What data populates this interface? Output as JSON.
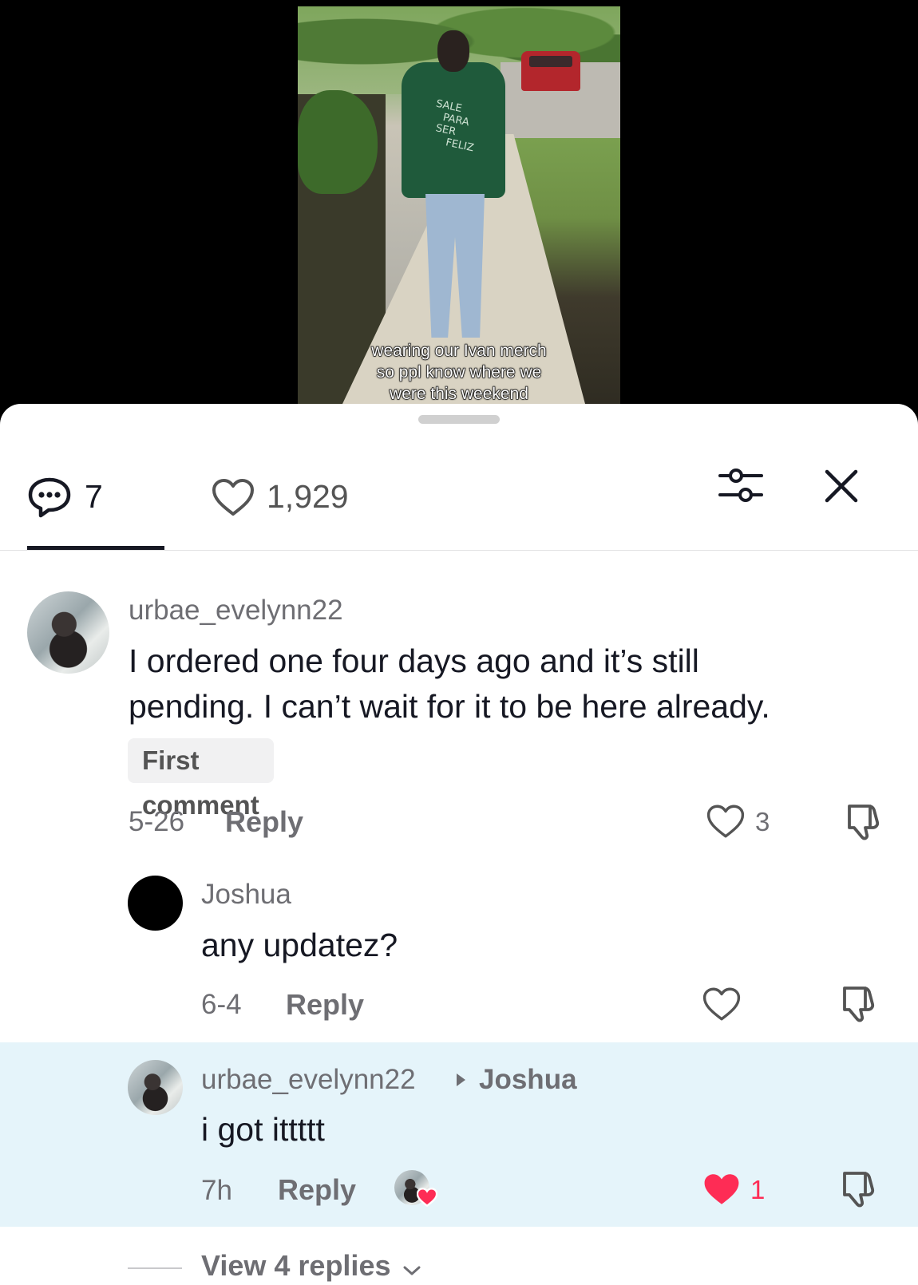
{
  "video": {
    "caption_lines": [
      "wearing our Ivan merch",
      "so ppl know where we",
      "were this weekend"
    ],
    "hoodie_text": [
      "SALE",
      "PARA",
      "SER",
      "FELIZ"
    ]
  },
  "tabs": {
    "comments_count": "7",
    "likes_count": "1,929",
    "active_tab": "comments"
  },
  "comments": [
    {
      "username": "urbae_evelynn22",
      "text_lines": [
        "I ordered one four days ago and it’s still",
        "pending. I can’t wait for it to be here already."
      ],
      "badge": "First comment",
      "date": "5-26",
      "reply_label": "Reply",
      "likes": "3",
      "liked": false
    },
    {
      "username": "Joshua",
      "text": "any updatez?",
      "date": "6-4",
      "reply_label": "Reply",
      "likes": "",
      "liked": false
    },
    {
      "username": "urbae_evelynn22",
      "reply_to": "Joshua",
      "text": "i got ittttt",
      "date": "7h",
      "reply_label": "Reply",
      "likes": "1",
      "liked": true,
      "creator_liked": true
    }
  ],
  "view_replies": "View 4 replies",
  "colors": {
    "like_active": "#fe2c55",
    "highlight_bg": "#e5f4fa",
    "text_primary": "#161823",
    "text_secondary": "#6e6e73"
  },
  "icons": [
    "comment-bubble-icon",
    "heart-outline-icon",
    "filter-sliders-icon",
    "close-icon",
    "dislike-icon",
    "heart-filled-icon",
    "chevron-down-icon"
  ]
}
